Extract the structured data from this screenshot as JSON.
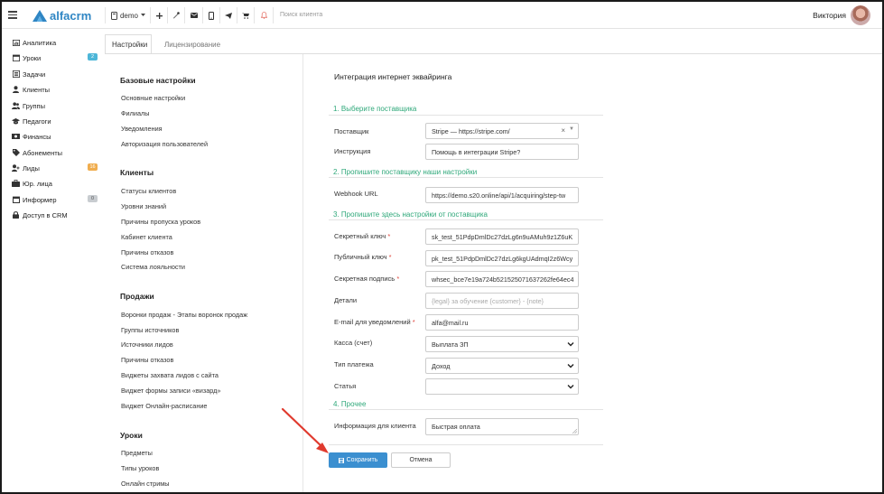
{
  "topbar": {
    "brand": "alfacrm",
    "branch": "demo",
    "search_placeholder": "Поиск клиента",
    "user_name": "Виктория"
  },
  "sidebar": {
    "items": [
      {
        "label": "Аналитика",
        "icon": "chart-icon"
      },
      {
        "label": "Уроки",
        "icon": "calendar-icon",
        "badge": "2",
        "badge_color": "#4db6d8"
      },
      {
        "label": "Задачи",
        "icon": "tasks-icon"
      },
      {
        "label": "Клиенты",
        "icon": "user-icon"
      },
      {
        "label": "Группы",
        "icon": "group-icon"
      },
      {
        "label": "Педагоги",
        "icon": "graduation-cap-icon"
      },
      {
        "label": "Финансы",
        "icon": "money-icon"
      },
      {
        "label": "Абонементы",
        "icon": "tag-icon"
      },
      {
        "label": "Лиды",
        "icon": "user-plus-icon",
        "badge": "16",
        "badge_color": "#f0ad4e"
      },
      {
        "label": "Юр. лица",
        "icon": "briefcase-icon"
      },
      {
        "label": "Информер",
        "icon": "calendar-icon",
        "badge": "0",
        "badge_color": "#c8ccd0"
      },
      {
        "label": "Доступ в CRM",
        "icon": "lock-icon"
      }
    ]
  },
  "tabs": [
    {
      "label": "Настройки",
      "active": true
    },
    {
      "label": "Лицензирование",
      "active": false
    }
  ],
  "settings_menu": {
    "basic_heading": "Базовые настройки",
    "basic_links": [
      "Основные настройки",
      "Филиалы",
      "Уведомления",
      "Авторизация пользователей"
    ],
    "clients_heading": "Клиенты",
    "clients_links": [
      "Статусы клиентов",
      "Уровни знаний",
      "Причины пропуска уроков",
      "Кабинет клиента",
      "Причины отказов",
      "Система лояльности"
    ],
    "sales_heading": "Продажи",
    "sales_links": [
      "Воронки продаж - Этапы воронок продаж",
      "Группы источников",
      "Источники лидов",
      "Причины отказов",
      "Виджеты захвата лидов с сайта",
      "Виджет формы записи «визард»",
      "Виджет Онлайн-расписание"
    ],
    "lessons_heading": "Уроки",
    "lessons_links": [
      "Предметы",
      "Типы уроков",
      "Онлайн стримы"
    ]
  },
  "form": {
    "title": "Интеграция интернет эквайринга",
    "section1": "1. Выберите поставщика",
    "provider_label": "Поставщик",
    "provider_value": "Stripe — https://stripe.com/",
    "instruction_label": "Инструкция",
    "instruction_value": "Помощь в интеграции Stripe?",
    "section2": "2. Пропишите поставщику наши настройки",
    "webhook_label": "Webhook URL",
    "webhook_value": "https://demo.s20.online/api/1/acquiring/step-tw",
    "section3": "3. Пропишите здесь настройки от поставщика",
    "secret_key_label": "Секретный ключ",
    "secret_key_value": "sk_test_51PdpDmlDc27dzLg6n9uAMuh9z1Z6uK",
    "public_key_label": "Публичный ключ",
    "public_key_value": "pk_test_51PdpDmlDc27dzLg6kgUAdmqI2z6Wcy",
    "secret_sign_label": "Секретная подпись",
    "secret_sign_value": "whsec_bce7e19a724b521525071637262fe64ec4",
    "details_label": "Детали",
    "details_placeholder": "{legal} за обучение {customer} - {note}",
    "email_label": "E-mail для уведомлений",
    "email_value": "alfa@mail.ru",
    "cashbox_label": "Касса (счет)",
    "cashbox_value": "Выплата ЗП",
    "payment_type_label": "Тип платежа",
    "payment_type_value": "Доход",
    "article_label": "Статья",
    "article_value": "",
    "section4": "4. Прочее",
    "client_info_label": "Информация для клиента",
    "client_info_value": "Быстрая оплата",
    "required_mark": "*"
  },
  "buttons": {
    "save": "Сохранить",
    "cancel": "Отмена"
  },
  "colors": {
    "brand": "#2f86c4",
    "section": "#2fa87a",
    "save": "#3b8fd0",
    "required": "#e0443a",
    "annotation_arrow": "#e03a2e"
  }
}
